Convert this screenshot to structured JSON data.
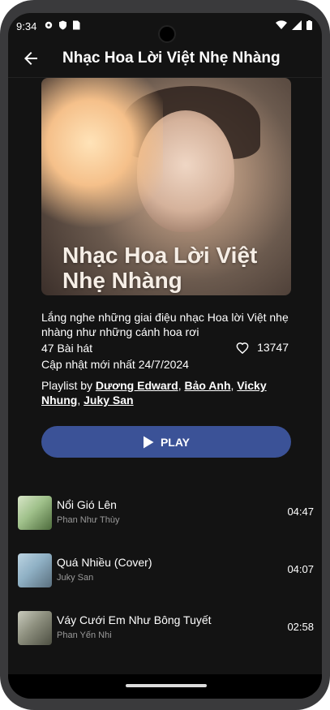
{
  "status": {
    "time": "9:34"
  },
  "header": {
    "title": "Nhạc Hoa Lời Việt Nhẹ Nhàng"
  },
  "cover": {
    "line1": "Nhạc Hoa Lời Việt",
    "line2": "Nhẹ Nhàng"
  },
  "info": {
    "description": "Lắng nghe những giai điệu nhạc Hoa lời Việt nhẹ nhàng như những cánh hoa rơi",
    "songs_count": "47 Bài hát",
    "likes": "13747",
    "updated": "Cập nhật mới nhất 24/7/2024",
    "playlist_prefix": "Playlist by ",
    "curators": [
      "Dương Edward",
      "Bảo Anh",
      "Vicky Nhung",
      "Juky San"
    ],
    "separator": ", "
  },
  "play": {
    "label": "PLAY"
  },
  "songs": [
    {
      "name": "Nổi Gió Lên",
      "artist": "Phan Như Thùy",
      "duration": "04:47"
    },
    {
      "name": "Quá Nhiều (Cover)",
      "artist": "Juky San",
      "duration": "04:07"
    },
    {
      "name": "Váy Cưới Em Như Bông Tuyết",
      "artist": "Phan Yến Nhi",
      "duration": "02:58"
    }
  ],
  "colors": {
    "background": "#131313",
    "play_button": "#3b5297",
    "secondary_text": "#9a9a9a"
  },
  "icons": [
    "gear-icon",
    "shield-icon",
    "sim-icon",
    "wifi-icon",
    "signal-icon",
    "battery-icon",
    "back-arrow-icon",
    "heart-icon",
    "play-icon"
  ]
}
